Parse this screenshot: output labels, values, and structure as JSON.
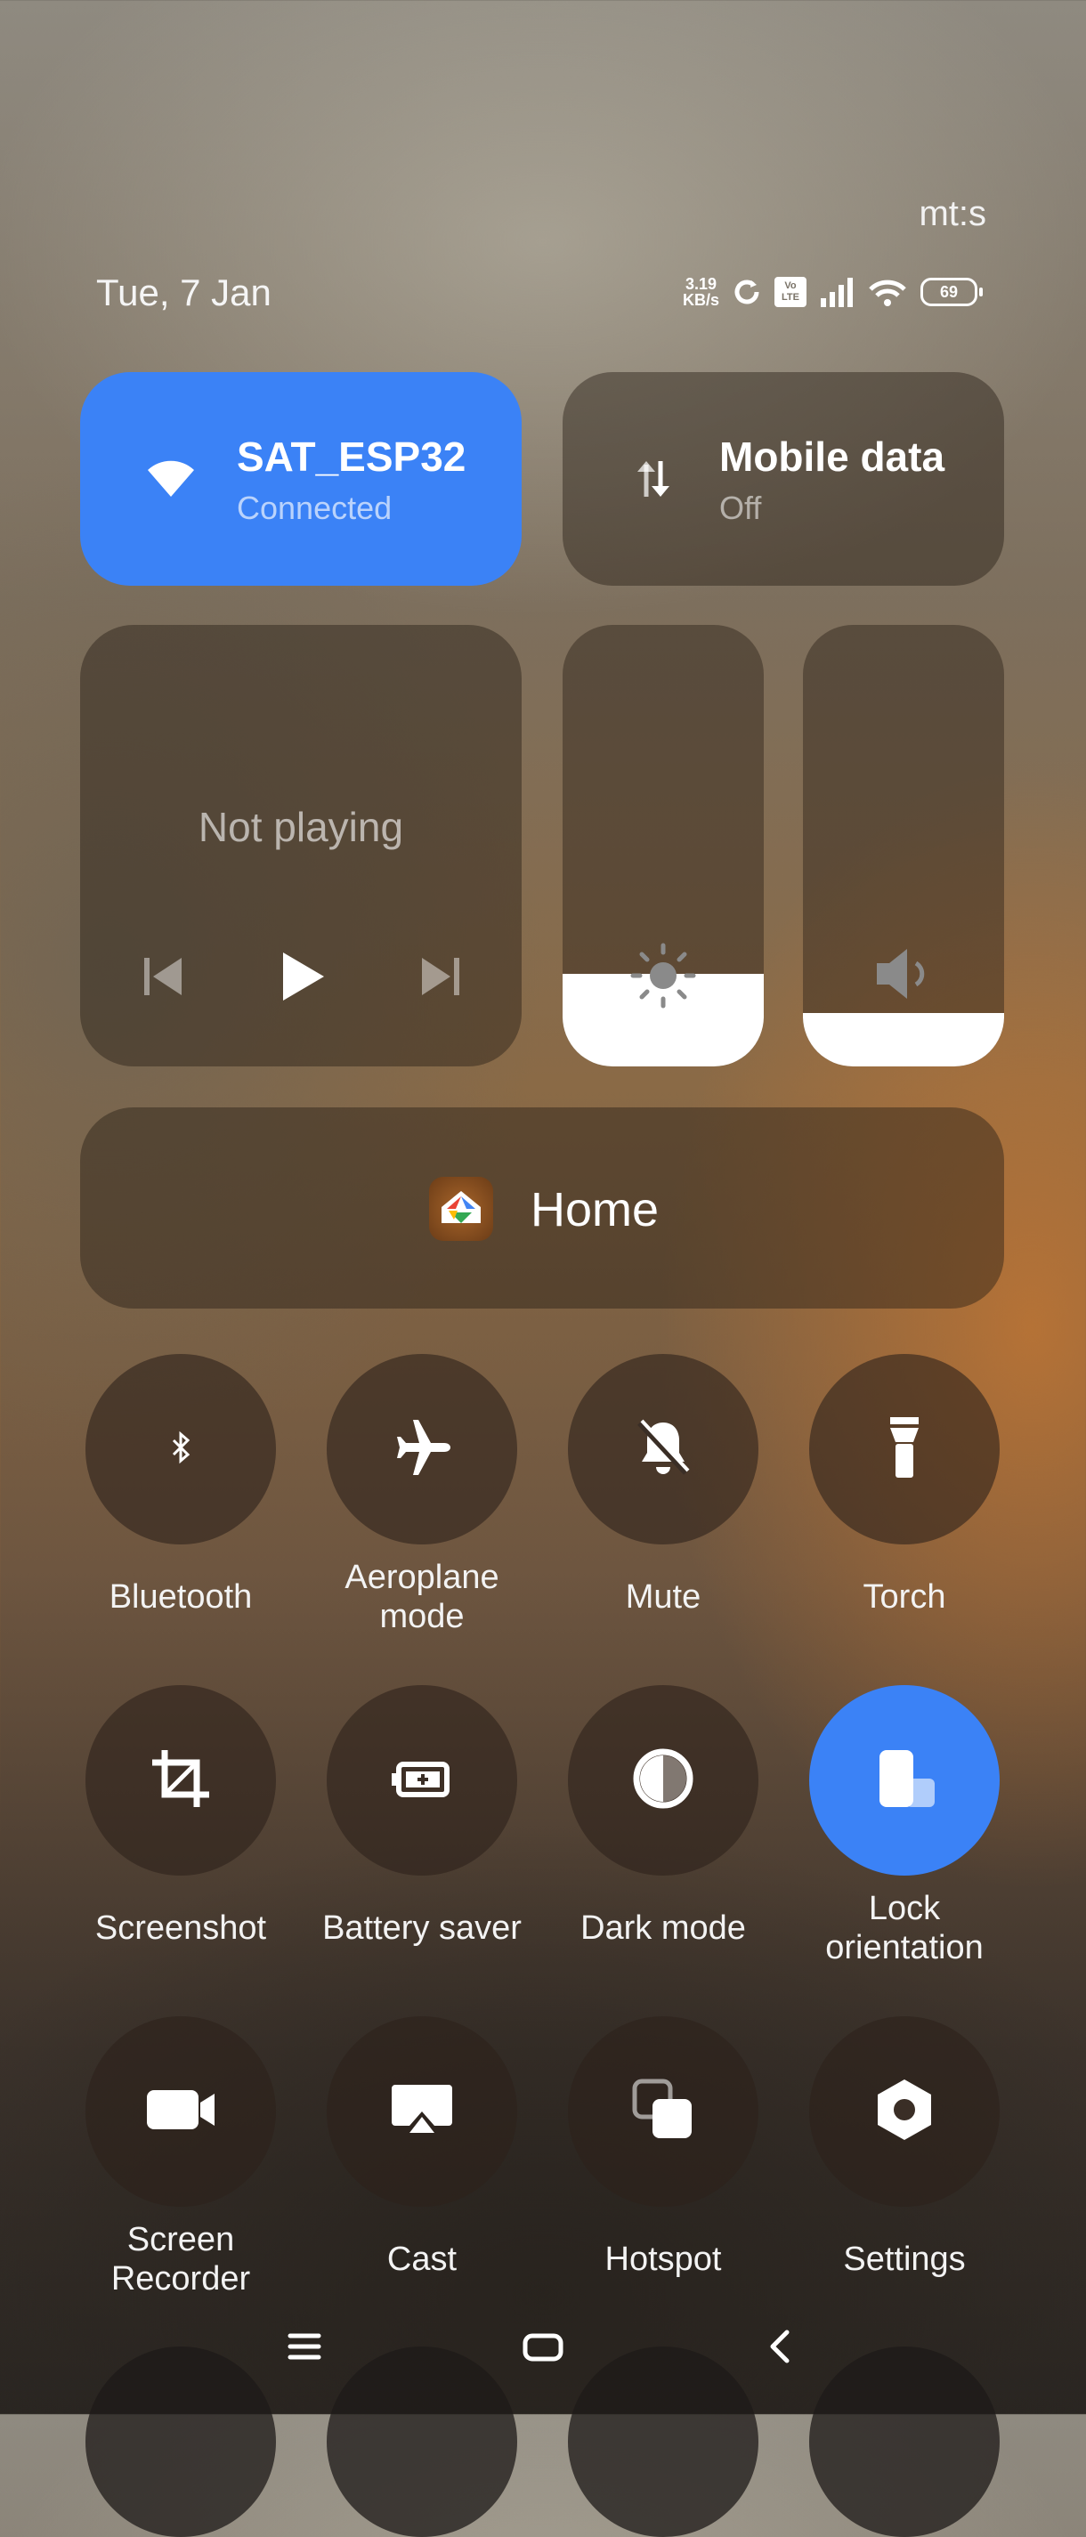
{
  "status_bar": {
    "top_right_label": "mt:s",
    "date": "Tue, 7 Jan",
    "speed_value": "3.19",
    "speed_unit": "KB/s",
    "volte_label_top": "Vo",
    "volte_label_bottom": "LTE",
    "battery_level": "69"
  },
  "tiles": {
    "wifi": {
      "title": "SAT_ESP32",
      "subtitle": "Connected",
      "active": true,
      "accent": "#3b82f6"
    },
    "mobile_data": {
      "title": "Mobile data",
      "subtitle": "Off",
      "active": false
    }
  },
  "media": {
    "status": "Not playing"
  },
  "sliders": {
    "brightness": {
      "icon": "sun-icon",
      "level": 0.21
    },
    "volume": {
      "icon": "speaker-icon",
      "level": 0.12
    }
  },
  "smart_home": {
    "label": "Home",
    "icon": "google-home-icon"
  },
  "quick_toggles": [
    {
      "label": "Bluetooth",
      "icon": "bluetooth-icon",
      "active": false
    },
    {
      "label": "Aeroplane\nmode",
      "icon": "airplane-icon",
      "active": false
    },
    {
      "label": "Mute",
      "icon": "bell-off-icon",
      "active": false
    },
    {
      "label": "Torch",
      "icon": "flashlight-icon",
      "active": false
    },
    {
      "label": "Screenshot",
      "icon": "crop-icon",
      "active": false
    },
    {
      "label": "Battery saver",
      "icon": "battery-plus-icon",
      "active": false
    },
    {
      "label": "Dark mode",
      "icon": "half-circle-icon",
      "active": false
    },
    {
      "label": "Lock\norientation",
      "icon": "rotation-lock-icon",
      "active": true
    },
    {
      "label": "Screen\nRecorder",
      "icon": "video-camera-icon",
      "active": false
    },
    {
      "label": "Cast",
      "icon": "cast-icon",
      "active": false
    },
    {
      "label": "Hotspot",
      "icon": "hotspot-icon",
      "active": false
    },
    {
      "label": "Settings",
      "icon": "gear-hex-icon",
      "active": false
    }
  ],
  "navigation": {
    "buttons": [
      "menu-icon",
      "home-icon",
      "back-icon"
    ]
  }
}
